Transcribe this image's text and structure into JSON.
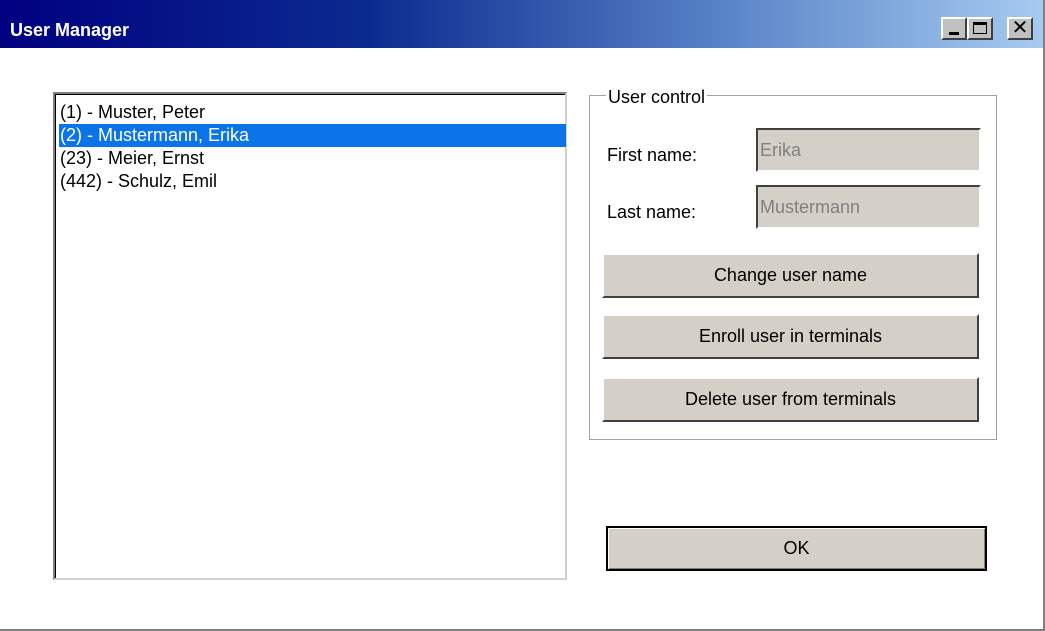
{
  "window": {
    "title": "User Manager"
  },
  "users_list": {
    "items": [
      "(1) - Muster, Peter",
      "(2) - Mustermann, Erika",
      "(23) - Meier, Ernst",
      "(442) - Schulz, Emil"
    ],
    "selected_index": 1
  },
  "user_control": {
    "legend": "User control",
    "first_name_label": "First name:",
    "first_name_value": "Erika",
    "last_name_label": "Last name:",
    "last_name_value": "Mustermann",
    "change_name_label": "Change user name",
    "enroll_label": "Enroll user in terminals",
    "delete_label": "Delete user from terminals"
  },
  "ok_label": "OK",
  "colors": {
    "selection": "#0a74e8",
    "title_bar_start": "#000080",
    "title_bar_end": "#a6caf0",
    "button_face": "#d4d0c8"
  }
}
